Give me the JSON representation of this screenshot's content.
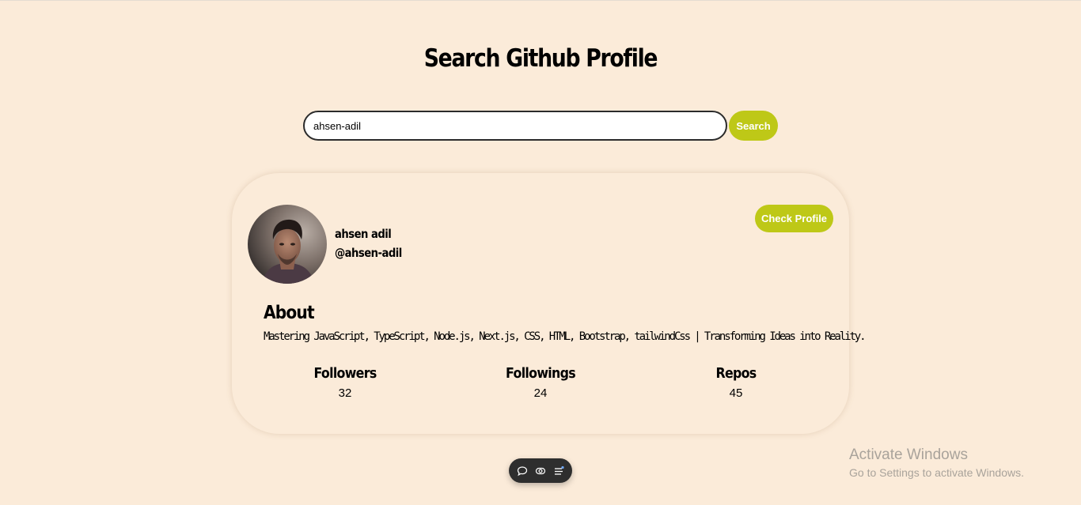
{
  "page": {
    "title": "Search Github Profile"
  },
  "search": {
    "value": "ahsen-adil",
    "button_label": "Search"
  },
  "profile": {
    "name": "ahsen adil",
    "login": "@ahsen-adil",
    "check_profile_label": "Check Profile",
    "about_heading": "About",
    "about_text": "Mastering JavaScript, TypeScript, Node.js, Next.js, CSS, HTML, Bootstrap, tailwindCss | Transforming Ideas into Reality.",
    "stats": [
      {
        "label": "Followers",
        "value": "32"
      },
      {
        "label": "Followings",
        "value": "24"
      },
      {
        "label": "Repos",
        "value": "45"
      }
    ]
  },
  "toolbar": {
    "icons": [
      "comment-icon",
      "eye-icon",
      "settings-list-icon"
    ]
  },
  "windows_watermark": {
    "title": "Activate Windows",
    "subtitle": "Go to Settings to activate Windows."
  },
  "colors": {
    "background": "#fbebd9",
    "accent": "#bec817",
    "toolbar": "#2e2e2e",
    "watermark": "#a9a39b"
  }
}
